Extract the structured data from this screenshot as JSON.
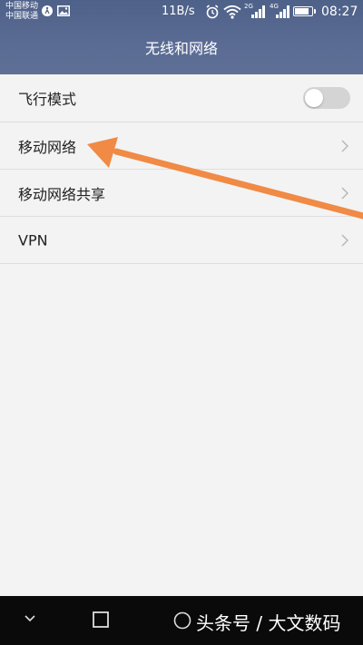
{
  "status_bar": {
    "carrier_1": "中国移动",
    "carrier_2": "中国联通",
    "net_speed": "11B/s",
    "sim1_label": "2G",
    "sim2_label": "4G",
    "time": "08:27",
    "battery_level": 0.9
  },
  "header": {
    "title": "无线和网络"
  },
  "settings": {
    "items": [
      {
        "label": "飞行模式",
        "type": "toggle",
        "enabled": false
      },
      {
        "label": "移动网络",
        "type": "link"
      },
      {
        "label": "移动网络共享",
        "type": "link"
      },
      {
        "label": "VPN",
        "type": "link"
      }
    ]
  },
  "annotation": {
    "arrow_color": "#f08a45",
    "points_to": "移动网络"
  },
  "nav_bar": {
    "watermark": "头条号 / 大文数码"
  },
  "colors": {
    "header_bg": "#56678f",
    "list_bg": "#f3f3f3",
    "divider": "#dedede",
    "toggle_off": "#d4d4d4",
    "nav_bg": "#0a0a0a"
  }
}
